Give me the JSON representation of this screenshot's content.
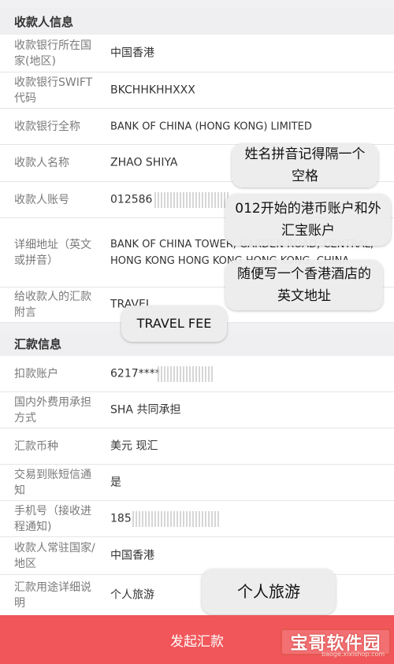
{
  "sections": {
    "payee": "收款人信息",
    "remit": "汇款信息"
  },
  "payee_rows": [
    {
      "label": "收款银行所在国家(地区)",
      "value": "中国香港"
    },
    {
      "label": "收款银行SWIFT代码",
      "value": "BKCHHKHHXXX"
    },
    {
      "label": "收款银行全称",
      "value": "BANK OF CHINA (HONG KONG) LIMITED"
    },
    {
      "label": "收款人名称",
      "value": "ZHAO SHIYA"
    },
    {
      "label": "收款人账号",
      "value": "012586"
    },
    {
      "label": "详细地址（英文或拼音）",
      "value": "BANK OF CHINA TOWER, GARDEN ROAD, CENTRAL, HONG KONG HONG KONG HONG KONG, CHINA"
    },
    {
      "label": "给收款人的汇款附言",
      "value": "TRAVEL"
    }
  ],
  "remit_rows": [
    {
      "label": "扣款账户",
      "value": "6217****"
    },
    {
      "label": "国内外费用承担方式",
      "value": "SHA 共同承担"
    },
    {
      "label": "汇款币种",
      "value": "美元 现汇"
    },
    {
      "label": "交易到账短信通知",
      "value": "是"
    },
    {
      "label": "手机号（接收进程通知)",
      "value": "185"
    },
    {
      "label": "收款人常驻国家/地区",
      "value": "中国香港"
    },
    {
      "label": "汇款用途详细说明",
      "value": "个人旅游"
    }
  ],
  "annotations": {
    "name_note": "姓名拼音记得隔一个空格",
    "account_note": "012开始的港币账户和外汇宝账户",
    "address_note": "随便写一个香港酒店的英文地址",
    "memo_note": "TRAVEL FEE",
    "purpose_note": "个人旅游"
  },
  "submit_label": "发起汇款",
  "watermark": {
    "brand": "宝哥软件园",
    "site": "baoge.xixishop.com"
  }
}
